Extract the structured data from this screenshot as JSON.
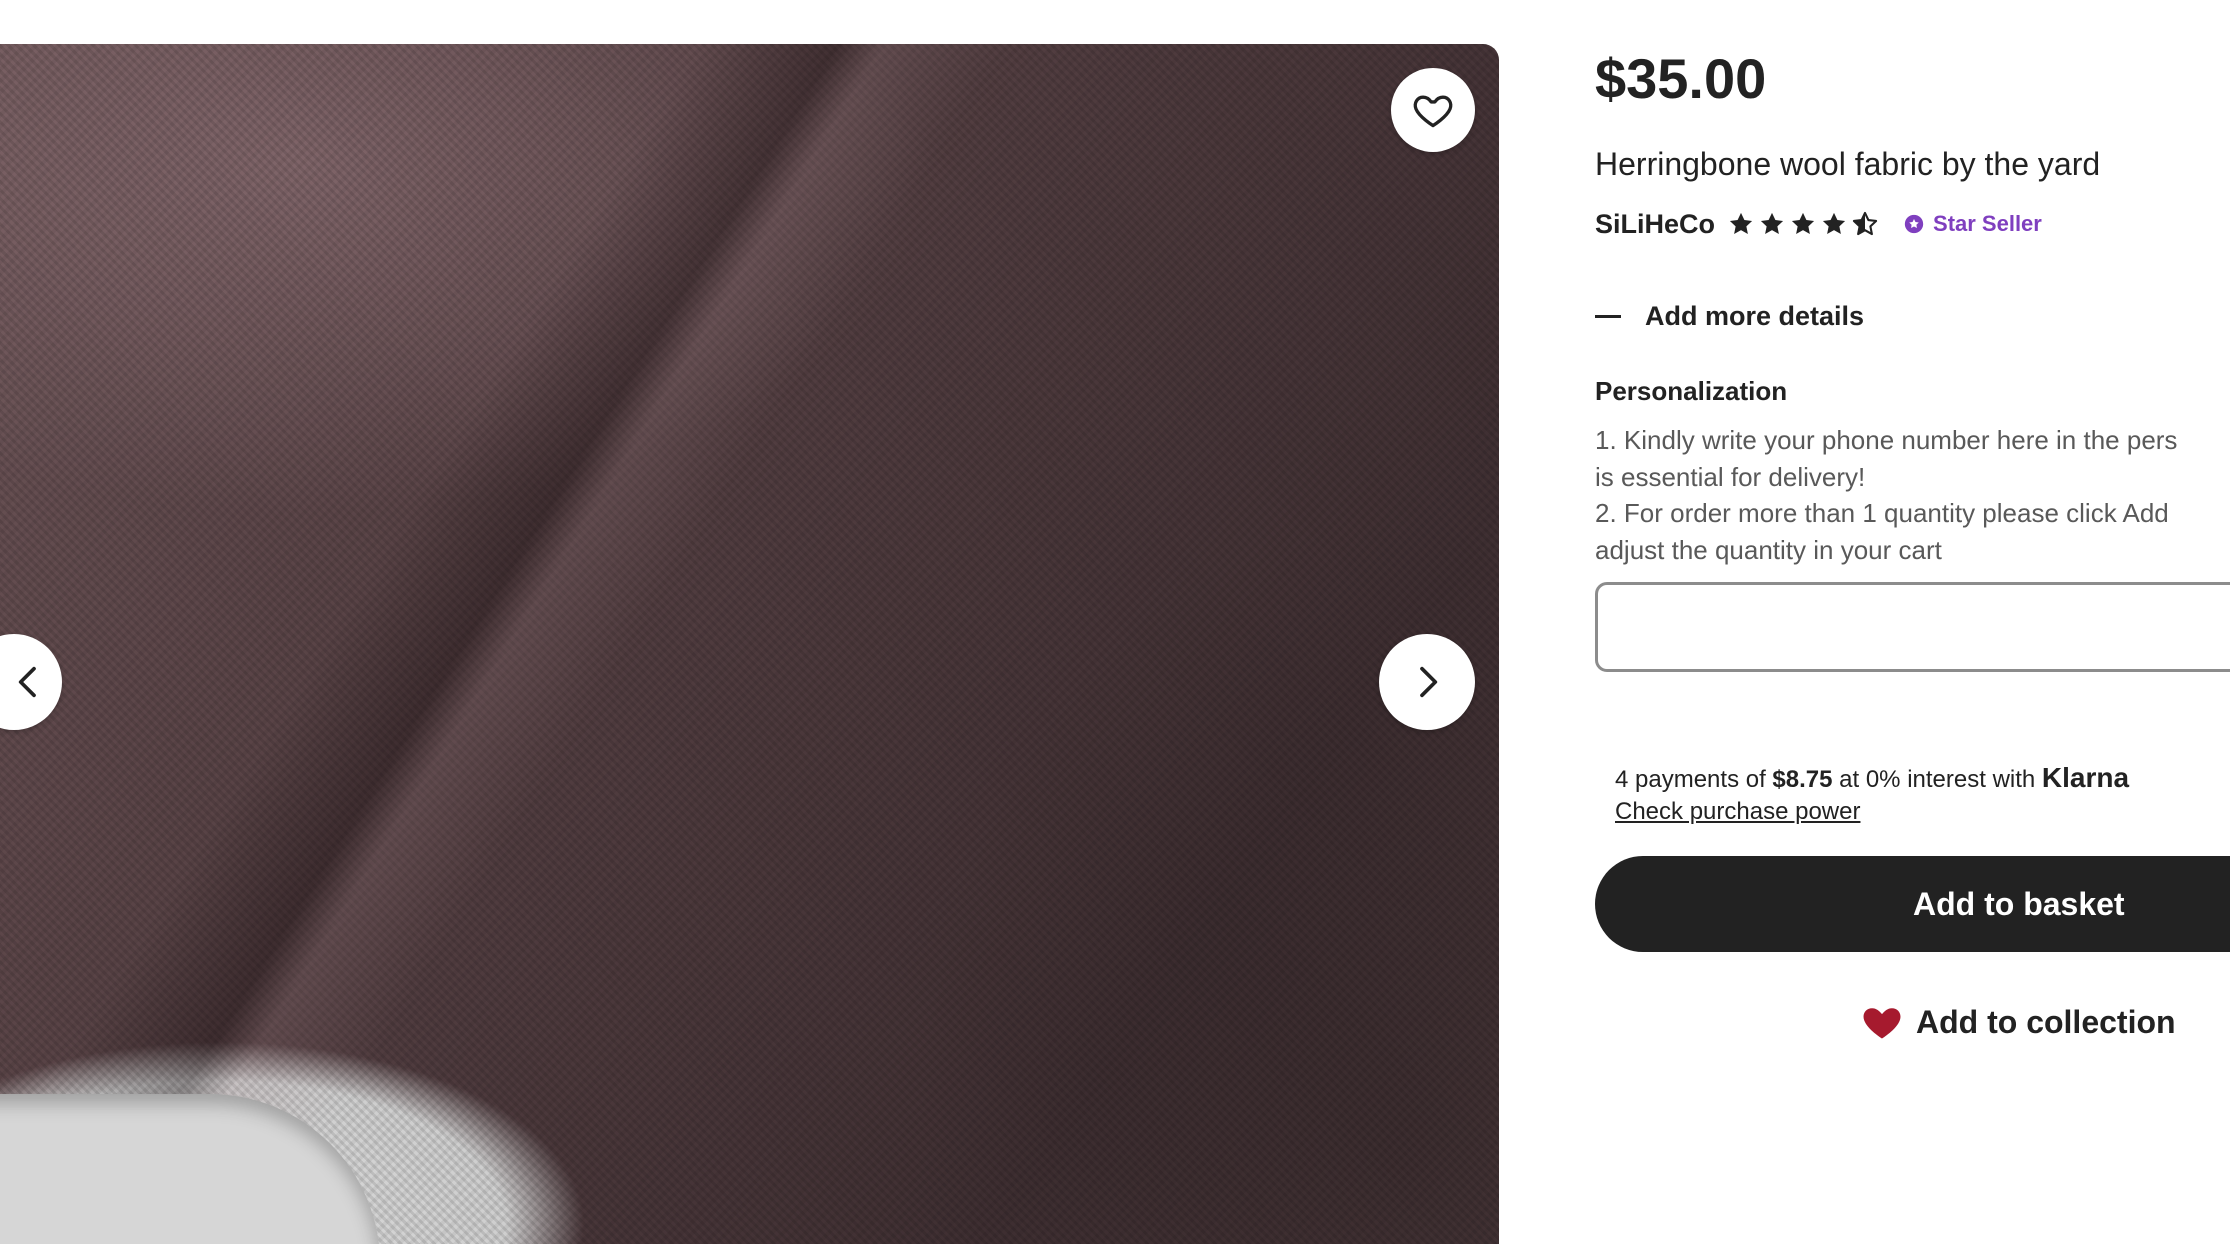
{
  "listing": {
    "price": "$35.00",
    "title": "Herringbone wool fabric by the yard",
    "seller": {
      "name": "SiLiHeCo",
      "rating": 4.5,
      "rating_max": 5,
      "badge": "Star Seller",
      "badge_color": "#7f3fbf"
    }
  },
  "details": {
    "toggle_label": "Add more details"
  },
  "personalization": {
    "label": "Personalization",
    "instructions": [
      "1. Kindly write your phone number here in the pers",
      "is essential for delivery!",
      "2. For order more than 1 quantity please click Add",
      "adjust the quantity in your cart"
    ],
    "value": ""
  },
  "klarna": {
    "prefix": "4 payments of ",
    "amount": "$8.75",
    "middle": " at 0% interest with ",
    "brand": "Klarna",
    "link": "Check purchase power"
  },
  "actions": {
    "add_to_basket": "Add to basket",
    "add_to_collection": "Add to collection",
    "basket_color": "#222222",
    "heart_color": "#a61a2e"
  },
  "image": {
    "favorite_icon": "heart-outline-icon",
    "prev_icon": "chevron-left-icon",
    "next_icon": "chevron-right-icon"
  }
}
